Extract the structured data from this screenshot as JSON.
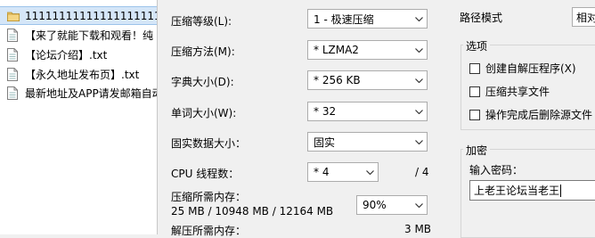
{
  "files": [
    {
      "name": "111111111111111111111",
      "type": "folder",
      "selected": true
    },
    {
      "name": "【来了就能下载和观看！纯",
      "type": "doc"
    },
    {
      "name": "【论坛介绍】.txt",
      "type": "doc"
    },
    {
      "name": "【永久地址发布页】.txt",
      "type": "doc"
    },
    {
      "name": "最新地址及APP请发邮箱自动",
      "type": "doc"
    }
  ],
  "form": {
    "level": {
      "label": "压缩等级(L):",
      "value": "1 - 极速压缩"
    },
    "method": {
      "label": "压缩方法(M):",
      "value": "* LZMA2"
    },
    "dict": {
      "label": "字典大小(D):",
      "value": "* 256 KB"
    },
    "word": {
      "label": "单词大小(W):",
      "value": "* 32"
    },
    "solid": {
      "label": "固实数据大小：",
      "value": "固实"
    },
    "cpu": {
      "label": "CPU 线程数：",
      "value": "* 4",
      "total": "/ 4"
    },
    "mem_compress": {
      "label": "压缩所需内存：",
      "value": "25 MB / 10948 MB / 12164 MB",
      "percent": "90%"
    },
    "mem_decompress": {
      "label": "解压所需内存：",
      "value": "3 MB"
    }
  },
  "path_mode": {
    "label": "路径模式",
    "value": "相对"
  },
  "options": {
    "title": "选项",
    "items": [
      {
        "label": "创建自解压程序(X)",
        "checked": false
      },
      {
        "label": "压缩共享文件",
        "checked": false
      },
      {
        "label": "操作完成后删除源文件",
        "checked": false
      }
    ]
  },
  "encryption": {
    "title": "加密",
    "password_label": "输入密码：",
    "password_value": "上老王论坛当老王"
  }
}
